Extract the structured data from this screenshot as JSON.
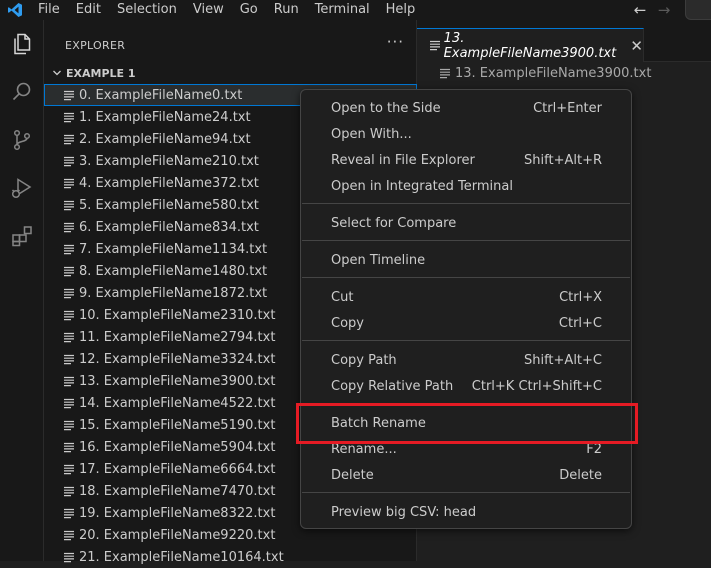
{
  "menubar": {
    "items": [
      "File",
      "Edit",
      "Selection",
      "View",
      "Go",
      "Run",
      "Terminal",
      "Help"
    ],
    "logo_icon": "vscode-logo-icon",
    "accent": "#0078d4"
  },
  "sidebar": {
    "title": "EXPLORER",
    "more_label": "···",
    "section_title": "EXAMPLE 1",
    "files": [
      "0. ExampleFileName0.txt",
      "1. ExampleFileName24.txt",
      "2. ExampleFileName94.txt",
      "3. ExampleFileName210.txt",
      "4. ExampleFileName372.txt",
      "5. ExampleFileName580.txt",
      "6. ExampleFileName834.txt",
      "7. ExampleFileName1134.txt",
      "8. ExampleFileName1480.txt",
      "9. ExampleFileName1872.txt",
      "10. ExampleFileName2310.txt",
      "11. ExampleFileName2794.txt",
      "12. ExampleFileName3324.txt",
      "13. ExampleFileName3900.txt",
      "14. ExampleFileName4522.txt",
      "15. ExampleFileName5190.txt",
      "16. ExampleFileName5904.txt",
      "17. ExampleFileName6664.txt",
      "18. ExampleFileName7470.txt",
      "19. ExampleFileName8322.txt",
      "20. ExampleFileName9220.txt",
      "21. ExampleFileName10164.txt"
    ]
  },
  "editor": {
    "tab_label": "13. ExampleFileName3900.txt",
    "tab_close": "✕",
    "breadcrumb": "13. ExampleFileName3900.txt"
  },
  "context_menu": {
    "items": [
      {
        "label": "Open to the Side",
        "shortcut": "Ctrl+Enter"
      },
      {
        "label": "Open With...",
        "shortcut": ""
      },
      {
        "label": "Reveal in File Explorer",
        "shortcut": "Shift+Alt+R"
      },
      {
        "label": "Open in Integrated Terminal",
        "shortcut": ""
      },
      {
        "label": "Select for Compare",
        "shortcut": ""
      },
      {
        "label": "Open Timeline",
        "shortcut": ""
      },
      {
        "label": "Cut",
        "shortcut": "Ctrl+X"
      },
      {
        "label": "Copy",
        "shortcut": "Ctrl+C"
      },
      {
        "label": "Copy Path",
        "shortcut": "Shift+Alt+C"
      },
      {
        "label": "Copy Relative Path",
        "shortcut": "Ctrl+K Ctrl+Shift+C"
      },
      {
        "label": "Batch Rename",
        "shortcut": ""
      },
      {
        "label": "Rename...",
        "shortcut": "F2"
      },
      {
        "label": "Delete",
        "shortcut": "Delete"
      },
      {
        "label": "Preview big CSV: head",
        "shortcut": ""
      }
    ]
  },
  "highlight_color": "#e51b24"
}
